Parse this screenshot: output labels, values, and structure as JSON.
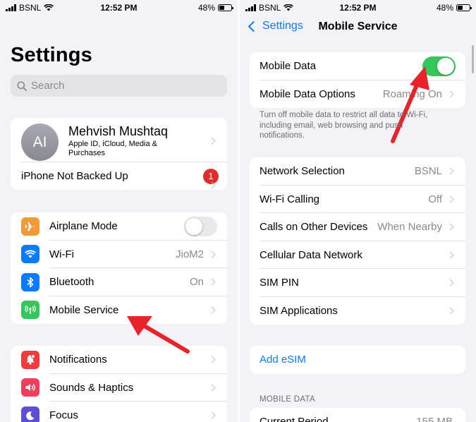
{
  "left": {
    "status": {
      "carrier": "BSNL",
      "time": "12:52 PM",
      "battery": "48%"
    },
    "title": "Settings",
    "search": {
      "placeholder": "Search"
    },
    "profile": {
      "initials": "AI",
      "name": "Mehvish Mushtaq",
      "subtitle": "Apple ID, iCloud, Media & Purchases",
      "backup_label": "iPhone Not Backed Up",
      "backup_badge": "1"
    },
    "connectivity": [
      {
        "label": "Airplane Mode",
        "icon": "airplane-icon",
        "color": "#f29a38",
        "toggle": "off"
      },
      {
        "label": "Wi-Fi",
        "icon": "wifi-icon",
        "color": "#0a7aff",
        "value": "JioM2"
      },
      {
        "label": "Bluetooth",
        "icon": "bluetooth-icon",
        "color": "#0a7aff",
        "value": "On"
      },
      {
        "label": "Mobile Service",
        "icon": "antenna-icon",
        "color": "#34c759"
      }
    ],
    "general": [
      {
        "label": "Notifications",
        "icon": "bell-icon",
        "color": "#f03c3c"
      },
      {
        "label": "Sounds & Haptics",
        "icon": "speaker-icon",
        "color": "#f03f5a"
      },
      {
        "label": "Focus",
        "icon": "moon-icon",
        "color": "#5b4fd6"
      }
    ]
  },
  "right": {
    "status": {
      "carrier": "BSNL",
      "time": "12:52 PM",
      "battery": "48%"
    },
    "back_label": "Settings",
    "title": "Mobile Service",
    "data_group": [
      {
        "label": "Mobile Data",
        "toggle": "on"
      },
      {
        "label": "Mobile Data Options",
        "value": "Roaming On"
      }
    ],
    "note": "Turn off mobile data to restrict all data to Wi-Fi, including email, web browsing and push notifications.",
    "network_group": [
      {
        "label": "Network Selection",
        "value": "BSNL"
      },
      {
        "label": "Wi-Fi Calling",
        "value": "Off"
      },
      {
        "label": "Calls on Other Devices",
        "value": "When Nearby"
      },
      {
        "label": "Cellular Data Network",
        "value": ""
      },
      {
        "label": "SIM PIN",
        "value": ""
      },
      {
        "label": "SIM Applications",
        "value": ""
      }
    ],
    "add_esim": "Add eSIM",
    "section_header": "MOBILE DATA",
    "current_period": {
      "label": "Current Period",
      "value": "155 MB"
    }
  },
  "colors": {
    "accent": "#0a7aff",
    "toggle_on": "#34c759",
    "badge": "#e22c2c",
    "arrow": "#e8232a"
  }
}
